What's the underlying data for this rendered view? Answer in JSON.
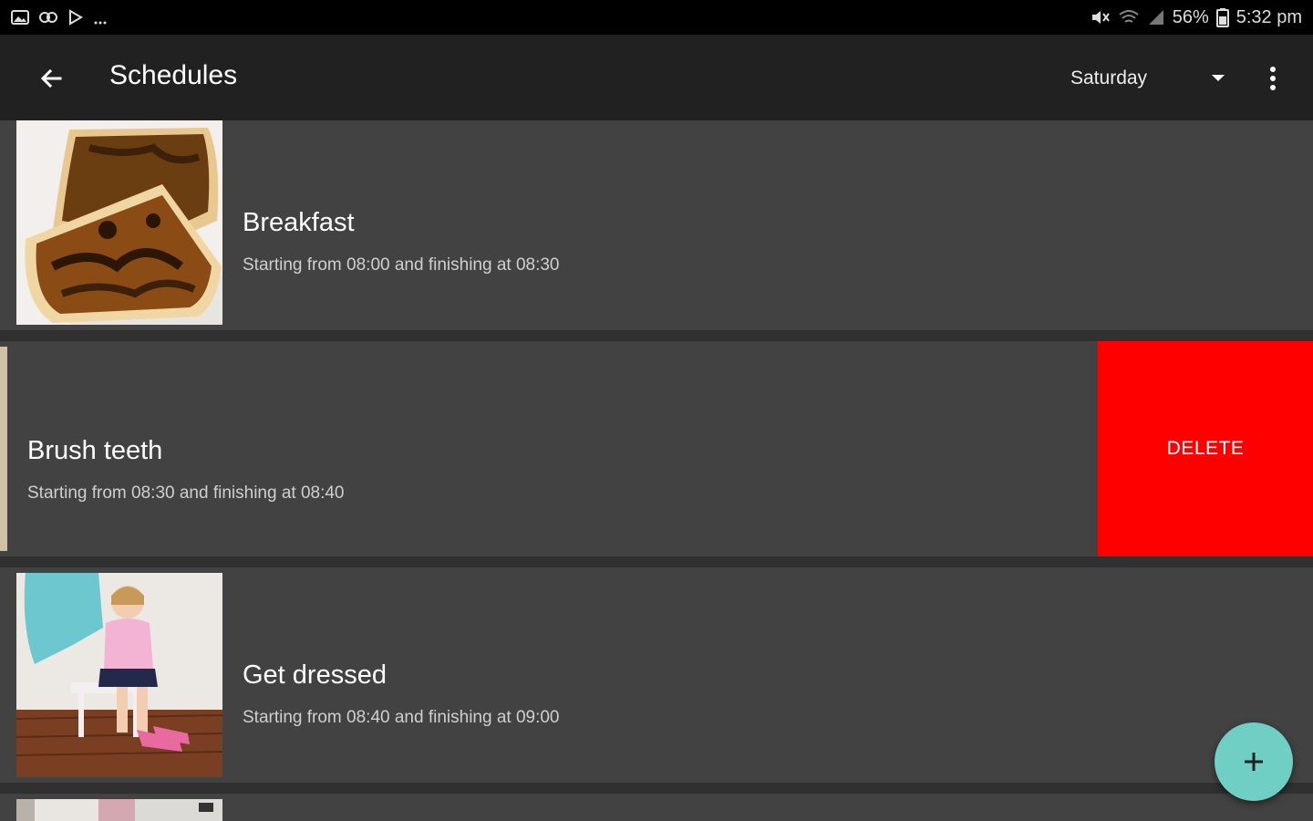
{
  "status_bar": {
    "battery": "56%",
    "time": "5:32 pm"
  },
  "app_bar": {
    "title": "Schedules",
    "day_selected": "Saturday"
  },
  "schedules": [
    {
      "title": "Breakfast",
      "subtitle": "Starting from 08:00 and finishing at 08:30"
    },
    {
      "title": "Brush teeth",
      "subtitle": "Starting from 08:30 and finishing at 08:40"
    },
    {
      "title": "Get dressed",
      "subtitle": "Starting from 08:40 and finishing at 09:00"
    }
  ],
  "delete_label": "DELETE",
  "colors": {
    "delete": "#ff0000",
    "fab": "#6fcfc4",
    "card": "#424242",
    "app_bar": "#212121"
  },
  "icons": {
    "back": "arrow-left-icon",
    "dropdown": "caret-down-icon",
    "more": "more-vert-icon",
    "fab": "plus-icon"
  }
}
